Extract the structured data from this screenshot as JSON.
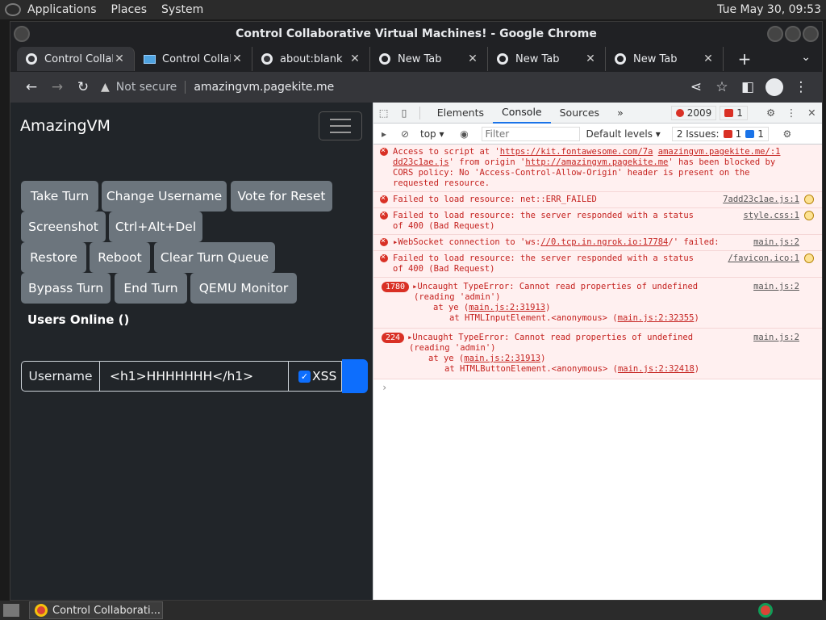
{
  "panel": {
    "menus": [
      "Applications",
      "Places",
      "System"
    ],
    "clock": "Tue May 30, 09:53"
  },
  "window": {
    "title": "Control Collaborative Virtual Machines! - Google Chrome"
  },
  "tabs": [
    {
      "label": "Control Collab",
      "icon": "globe-icon",
      "active": true
    },
    {
      "label": "Control Collab",
      "icon": "monitor-icon",
      "active": false
    },
    {
      "label": "about:blank",
      "icon": "globe-icon",
      "active": false
    },
    {
      "label": "New Tab",
      "icon": "chrome-icon",
      "active": false
    },
    {
      "label": "New Tab",
      "icon": "chrome-icon",
      "active": false
    },
    {
      "label": "New Tab",
      "icon": "chrome-icon",
      "active": false
    }
  ],
  "omnibox": {
    "security": "Not secure",
    "url": "amazingvm.pagekite.me"
  },
  "page": {
    "brand": "AmazingVM",
    "buttons": {
      "take_turn": "Take Turn",
      "change_username": "Change Username",
      "vote_reset": "Vote for Reset",
      "screenshot": "Screenshot",
      "ctrl_alt_del": "Ctrl+Alt+Del",
      "restore": "Restore",
      "reboot": "Reboot",
      "clear_queue": "Clear Turn Queue",
      "bypass_turn": "Bypass Turn",
      "end_turn": "End Turn",
      "qemu_monitor": "QEMU Monitor"
    },
    "users_online": "Users Online ()",
    "chat": {
      "label": "Username",
      "value": "<h1>HHHHHHH</h1>",
      "xss_label": "XSS"
    }
  },
  "devtools": {
    "tabs": [
      "Elements",
      "Console",
      "Sources"
    ],
    "error_count": "2009",
    "warn_count": "1",
    "context": "top",
    "filter_placeholder": "Filter",
    "levels": "Default levels",
    "issues_label": "2 Issues:",
    "issues_red": "1",
    "issues_blue": "1",
    "messages": {
      "m1": {
        "pre": "Access to script at '",
        "link1": "https://kit.fontawesome.com/7a",
        "link2": "dd23c1ae.js",
        "mid": "' from origin '",
        "link3": "http://amazingvm.pagekite.me",
        "post": "' has been blocked by CORS policy: No 'Access-Control-Allow-Origin' header is present on the requested resource.",
        "src": "amazingvm.pagekite.me/:1"
      },
      "m2": {
        "text": "Failed to load resource: net::ERR_FAILED",
        "src": "7add23c1ae.js:1"
      },
      "m3": {
        "text": "Failed to load resource: the server responded with a status of 400 (Bad Request)",
        "src": "style.css:1"
      },
      "m4": {
        "pre": "WebSocket connection to 'ws:",
        "link": "//0.tcp.in.ngrok.io:17784",
        "post": "/' failed:",
        "src": "main.js:2"
      },
      "m5": {
        "text": "Failed to load resource: the server responded with a status of 400 (Bad Request)",
        "src": "/favicon.ico:1"
      },
      "m6": {
        "count": "1780",
        "line1": "Uncaught TypeError: Cannot read properties of undefined",
        "line2": "(reading 'admin')",
        "at1": "at ye (",
        "at1link": "main.js:2:31913",
        "at2": "at HTMLInputElement.<anonymous> (",
        "at2link": "main.js:2:32355",
        "src": "main.js:2"
      },
      "m7": {
        "count": "224",
        "line1": "Uncaught TypeError: Cannot read properties of undefined",
        "line2": "(reading 'admin')",
        "at1": "at ye (",
        "at1link": "main.js:2:31913",
        "at2": "at HTMLButtonElement.<anonymous> (",
        "at2link": "main.js:2:32418",
        "src": "main.js:2"
      }
    }
  },
  "taskbar": {
    "task_label": "Control Collaborati..."
  }
}
